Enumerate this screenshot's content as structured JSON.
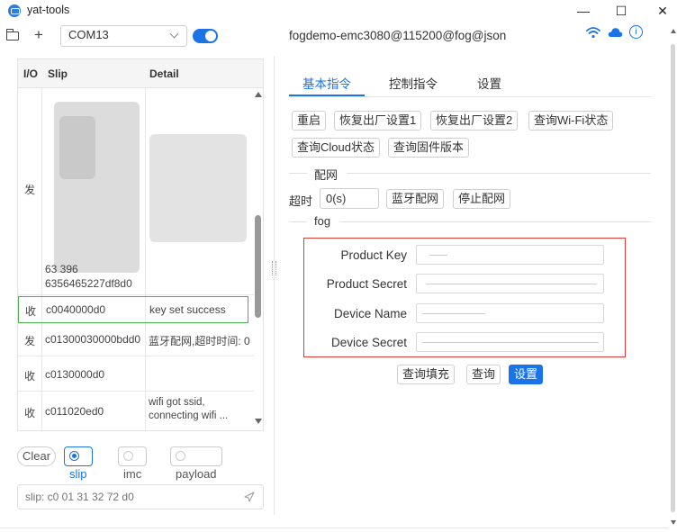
{
  "window": {
    "title": "yat-tools",
    "minimize": "—",
    "maximize": "☐",
    "close": "✕"
  },
  "toolbar": {
    "add": "+",
    "port": "COM13",
    "connected": true,
    "device_id": "fogdemo-emc3080@115200@fog@json",
    "icons": [
      "wifi-icon",
      "cloud-icon",
      "info-icon"
    ],
    "accent_color": "#1a73e8"
  },
  "log_table": {
    "headers": {
      "io": "I/O",
      "slip": "Slip",
      "detail": "Detail"
    },
    "rows": [
      {
        "io": "发",
        "slip": "63 396\n6356465227df8d0",
        "detail": ""
      },
      {
        "io": "收",
        "slip": "c0040000d0",
        "detail": "key set success"
      },
      {
        "io": "发",
        "slip": "c01300030000bdd0",
        "detail": "蓝牙配网,超时时间: 0"
      },
      {
        "io": "收",
        "slip": "c0130000d0",
        "detail": ""
      },
      {
        "io": "收",
        "slip": "c011020ed0",
        "detail": "wifi got ssid, connecting wifi ..."
      }
    ],
    "highlight_color": "#4caf50"
  },
  "filters": {
    "clear": "Clear",
    "options": [
      {
        "label": "slip",
        "selected": true
      },
      {
        "label": "imc",
        "selected": false
      },
      {
        "label": "payload",
        "selected": false
      }
    ]
  },
  "send": {
    "placeholder": "slip: c0 01 31 32 72 d0"
  },
  "tabs": [
    {
      "label": "基本指令",
      "active": true
    },
    {
      "label": "控制指令",
      "active": false
    },
    {
      "label": "设置",
      "active": false
    }
  ],
  "basic": {
    "row1": [
      "重启",
      "恢复出厂设置1",
      "恢复出厂设置2",
      "查询Wi-Fi状态"
    ],
    "row2": [
      "查询Cloud状态",
      "查询固件版本"
    ],
    "network_section": "配网",
    "timeout_label": "超时",
    "timeout_value": "0(s)",
    "ble_button": "蓝牙配网",
    "stop_button": "停止配网",
    "fog_section": "fog",
    "fields": [
      {
        "label": "Product Key"
      },
      {
        "label": "Product Secret"
      },
      {
        "label": "Device Name"
      },
      {
        "label": "Device Secret"
      }
    ],
    "actions": {
      "fill": "查询填充",
      "query": "查询",
      "set": "设置"
    },
    "highlight_color": "#e53935"
  }
}
